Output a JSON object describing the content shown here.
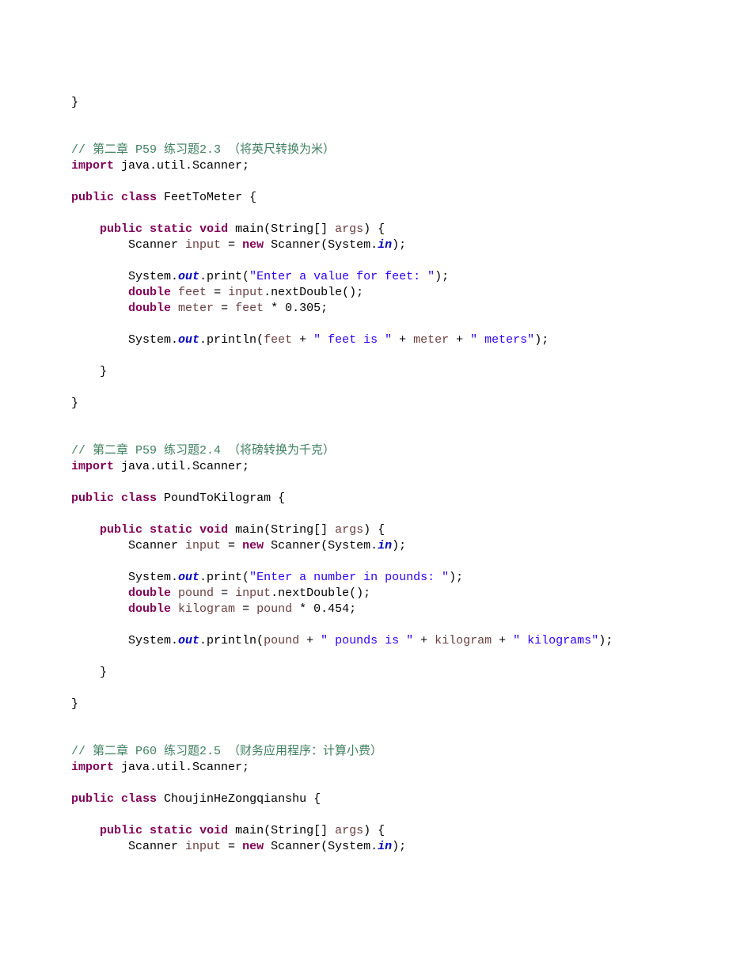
{
  "snippets": [
    {
      "comment": "// 第二章 P59 练习题2.3 （将英尺转换为米）",
      "import_line": "import java.util.Scanner;",
      "class_name": "FeetToMeter",
      "body": [
        {
          "t": "Scanner input = new Scanner(System.in);"
        },
        {
          "t": ""
        },
        {
          "t": "System.out.print(\"Enter a value for feet: \");"
        },
        {
          "t": "double feet = input.nextDouble();"
        },
        {
          "t": "double meter = feet * 0.305;"
        },
        {
          "t": ""
        },
        {
          "t": "System.out.println(feet + \" feet is \" + meter + \" meters\");"
        }
      ],
      "close": true
    },
    {
      "comment": "// 第二章 P59 练习题2.4 （将磅转换为千克）",
      "import_line": "import java.util.Scanner;",
      "class_name": "PoundToKilogram",
      "body": [
        {
          "t": "Scanner input = new Scanner(System.in);"
        },
        {
          "t": ""
        },
        {
          "t": "System.out.print(\"Enter a number in pounds: \");"
        },
        {
          "t": "double pound = input.nextDouble();"
        },
        {
          "t": "double kilogram = pound * 0.454;"
        },
        {
          "t": ""
        },
        {
          "t": "System.out.println(pound + \" pounds is \" + kilogram + \" kilograms\");"
        }
      ],
      "close": true
    },
    {
      "comment": "// 第二章 P60 练习题2.5 （财务应用程序：计算小费）",
      "import_line": "import java.util.Scanner;",
      "class_name": "ChoujinHeZongqianshu",
      "body": [
        {
          "t": "Scanner input = new Scanner(System.in);"
        }
      ],
      "close": false
    }
  ],
  "leading_lines": [
    "}"
  ],
  "tokens": {
    "keywords": [
      "public",
      "class",
      "static",
      "void",
      "import",
      "new",
      "double"
    ],
    "fields": [
      "out",
      "in"
    ],
    "main_sig": {
      "pre": "public static void",
      "name": "main",
      "args_type": "String[]",
      "args_name": "args"
    }
  }
}
